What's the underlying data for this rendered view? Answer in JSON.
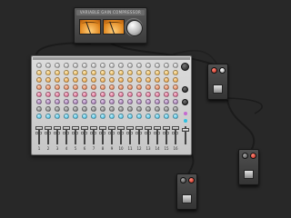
{
  "compressor": {
    "brand_label": "VARIABLE GAIN COMPRESSOR",
    "meters": [
      {
        "name": "left-vu-meter",
        "needle_angle_deg": -20
      },
      {
        "name": "right-vu-meter",
        "needle_angle_deg": -20
      }
    ],
    "knob_icon": "large-rotary-knob"
  },
  "mixer": {
    "channel_count": 16,
    "channel_labels": [
      "1",
      "2",
      "3",
      "4",
      "5",
      "6",
      "7",
      "8",
      "9",
      "10",
      "11",
      "12",
      "13",
      "14",
      "15",
      "16"
    ],
    "knob_rows": [
      "gain",
      "hi-eq",
      "mid-eq",
      "lo-eq",
      "aux-1",
      "aux-2",
      "aux-3",
      "pan"
    ],
    "knob_colors": {
      "gain": "#9a9a9a",
      "hi": "#e3a63a",
      "mid": "#e0902a",
      "lo": "#d46a3b",
      "aux1": "#cf4f7a",
      "aux2": "#8d5fa0",
      "aux3": "#6a6a6a",
      "pan": "#2fb3d9"
    },
    "fader_levels": [
      0.1,
      0.1,
      0.1,
      0.1,
      0.1,
      0.1,
      0.1,
      0.1,
      0.1,
      0.1,
      0.1,
      0.1,
      0.1,
      0.1,
      0.1,
      0.1
    ]
  },
  "pedals": [
    {
      "name": "pedal-top-right",
      "label": ""
    },
    {
      "name": "pedal-bottom-center",
      "label": ""
    },
    {
      "name": "pedal-bottom-right",
      "label": ""
    }
  ],
  "colors": {
    "background": "#282828",
    "mixer_panel": "#d0d0d0",
    "cable": "#1b1b1b",
    "vu_face": "#e0851d"
  }
}
